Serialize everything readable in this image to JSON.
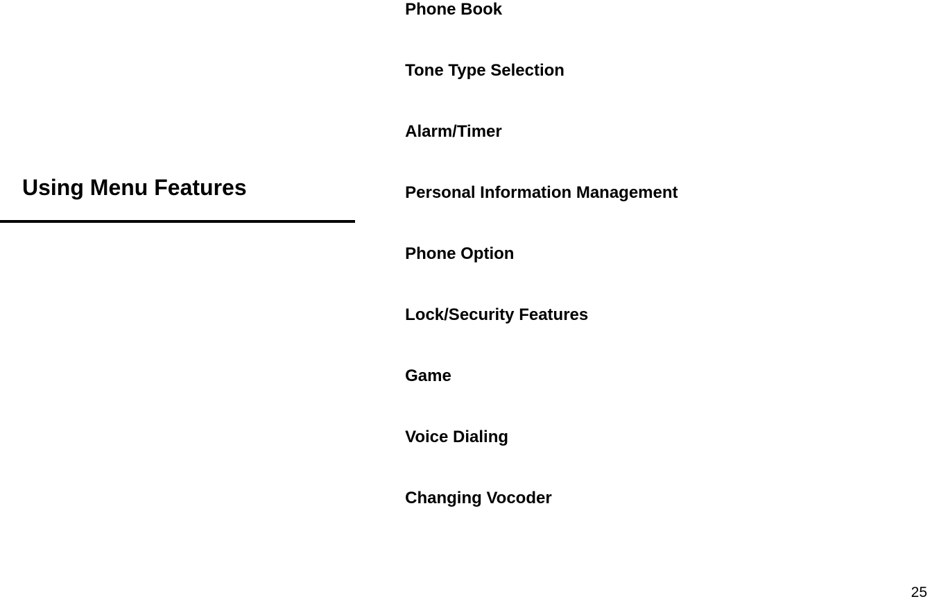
{
  "left": {
    "section_title": "Using Menu Features"
  },
  "right": {
    "items": [
      "Phone Book",
      "Tone Type Selection",
      "Alarm/Timer",
      "Personal Information Management",
      "Phone Option",
      "Lock/Security Features",
      "Game",
      "Voice Dialing",
      "Changing Vocoder"
    ]
  },
  "page_number": "25"
}
